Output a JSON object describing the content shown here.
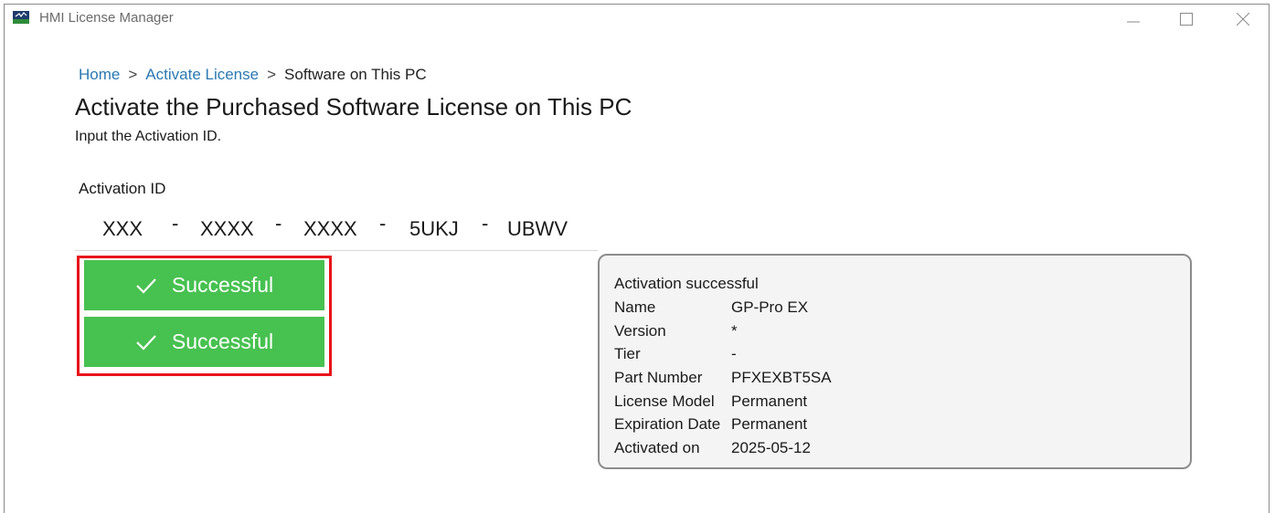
{
  "window": {
    "title": "HMI License Manager",
    "controls": [
      "minimize-icon",
      "maximize-icon",
      "close-icon"
    ]
  },
  "breadcrumb": {
    "items": [
      "Home",
      "Activate License",
      "Software on This PC"
    ],
    "separator": ">"
  },
  "page": {
    "title": "Activate the Purchased Software License on This PC",
    "subtitle": "Input the Activation ID."
  },
  "activation_id": {
    "label": "Activation ID",
    "segments": [
      "XXX",
      "XXXX",
      "XXXX",
      "5UKJ",
      "UBWV"
    ],
    "separator": "-"
  },
  "results": [
    {
      "label": "Successful",
      "icon": "checkmark-icon"
    },
    {
      "label": "Successful",
      "icon": "checkmark-icon"
    }
  ],
  "info": {
    "heading": "Activation successful",
    "rows": [
      {
        "key": "Name",
        "value": "GP-Pro EX"
      },
      {
        "key": "Version",
        "value": "*"
      },
      {
        "key": "Tier",
        "value": "-"
      },
      {
        "key": "Part Number",
        "value": "PFXEXBT5SA"
      },
      {
        "key": "License Model",
        "value": "Permanent"
      },
      {
        "key": "Expiration Date",
        "value": "Permanent"
      },
      {
        "key": "Activated on",
        "value": "2025-05-12"
      }
    ]
  },
  "colors": {
    "link": "#2a7ab3",
    "success": "#47c150",
    "highlight_border": "#e8141a"
  }
}
